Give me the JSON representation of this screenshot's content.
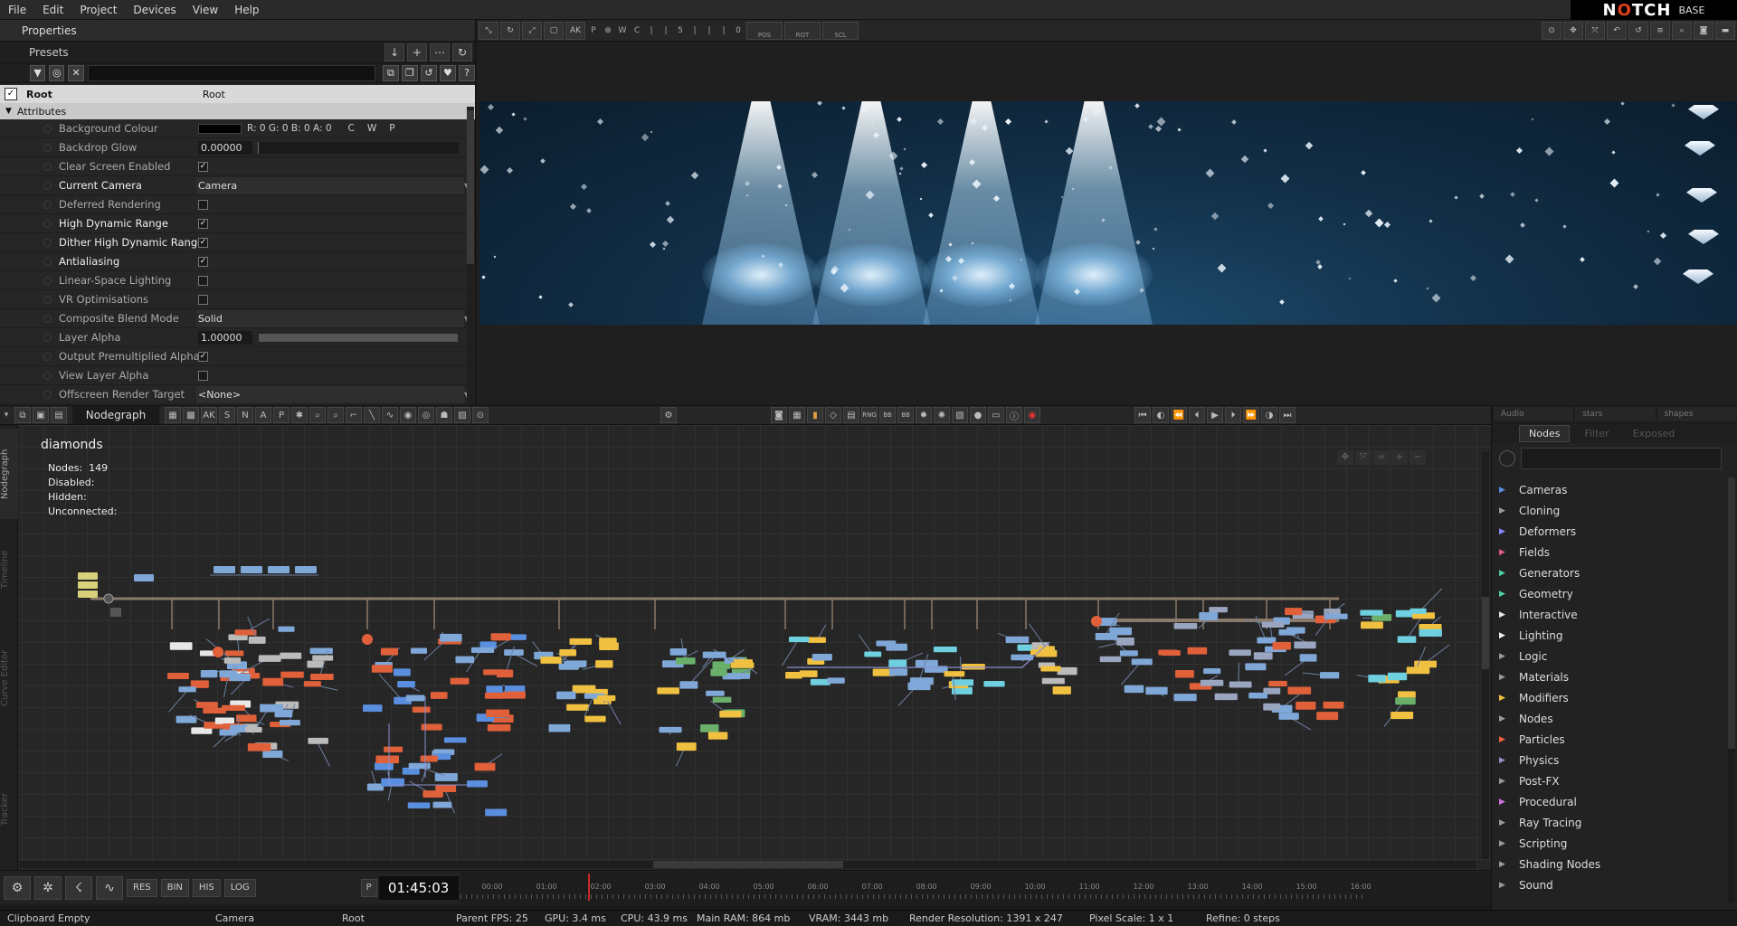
{
  "menu": [
    "File",
    "Edit",
    "Project",
    "Devices",
    "View",
    "Help"
  ],
  "logo": {
    "brand_prefix": "N",
    "brand_o": "O",
    "brand_suffix": "TCH",
    "edition": "BASE"
  },
  "properties": {
    "title": "Properties",
    "presets_label": "Presets",
    "root": {
      "label": "Root",
      "value": "Root"
    },
    "section": "Attributes",
    "rows": [
      {
        "label": "Background Colour",
        "type": "colour",
        "text": "R: 0 G: 0 B: 0 A: 0",
        "modes": [
          "C",
          "W",
          "P"
        ],
        "bright": false
      },
      {
        "label": "Backdrop Glow",
        "type": "number",
        "value": "0.00000",
        "bright": false
      },
      {
        "label": "Clear Screen Enabled",
        "type": "check",
        "checked": true,
        "bright": false
      },
      {
        "label": "Current Camera",
        "type": "drop",
        "value": "Camera",
        "bright": true
      },
      {
        "label": "Deferred Rendering",
        "type": "check",
        "checked": false,
        "bright": false
      },
      {
        "label": "High Dynamic Range",
        "type": "check",
        "checked": true,
        "bright": true
      },
      {
        "label": "Dither High Dynamic Range",
        "type": "check",
        "checked": true,
        "bright": true
      },
      {
        "label": "Antialiasing",
        "type": "check",
        "checked": true,
        "bright": true
      },
      {
        "label": "Linear-Space Lighting",
        "type": "check",
        "checked": false,
        "bright": false
      },
      {
        "label": "VR Optimisations",
        "type": "check",
        "checked": false,
        "bright": false
      },
      {
        "label": "Composite Blend Mode",
        "type": "drop",
        "value": "Solid",
        "bright": false
      },
      {
        "label": "Layer Alpha",
        "type": "slider",
        "value": "1.00000",
        "bright": false
      },
      {
        "label": "Output Premultiplied Alpha",
        "type": "check",
        "checked": true,
        "bright": false
      },
      {
        "label": "View Layer Alpha",
        "type": "check",
        "checked": false,
        "bright": false
      },
      {
        "label": "Offscreen Render Target",
        "type": "drop",
        "value": "<None>",
        "bright": false
      }
    ]
  },
  "viewport_toolbar": {
    "pos_label": "POS",
    "rot_label": "ROT",
    "scl_label": "SCL",
    "ak_label": "AK",
    "p_label": "P",
    "w_label": "W",
    "c_label": "C",
    "count_label": "5",
    "zero_label": "0"
  },
  "nodegraph": {
    "title": "Nodegraph",
    "toolbar_letters": [
      "AK",
      "S",
      "N",
      "A",
      "P"
    ],
    "toolbar_extra": [
      "RNG",
      "BB",
      "BB"
    ],
    "graph_name": "diamonds",
    "stats": {
      "nodes_label": "Nodes:",
      "nodes_value": "149",
      "disabled_label": "Disabled:",
      "hidden_label": "Hidden:",
      "unconnected_label": "Unconnected:"
    },
    "side_tabs": [
      "Nodegraph",
      "Timeline",
      "Curve Editor",
      "Tracker"
    ]
  },
  "node_bin": {
    "top_tabs": [
      "Audio",
      "stars",
      "shapes"
    ],
    "sub_tabs": [
      "Nodes",
      "Filter",
      "Exposed",
      "Exposed"
    ],
    "categories": [
      {
        "name": "Cameras",
        "color": "#5a8fe0"
      },
      {
        "name": "Cloning",
        "color": "#9a9a9a"
      },
      {
        "name": "Deformers",
        "color": "#8a8aff"
      },
      {
        "name": "Fields",
        "color": "#e05a8a"
      },
      {
        "name": "Generators",
        "color": "#4fcfa0"
      },
      {
        "name": "Geometry",
        "color": "#4fcfa0"
      },
      {
        "name": "Interactive",
        "color": "#e8e8e8"
      },
      {
        "name": "Lighting",
        "color": "#f0f0f0"
      },
      {
        "name": "Logic",
        "color": "#9a9a9a"
      },
      {
        "name": "Materials",
        "color": "#9a9a9a"
      },
      {
        "name": "Modifiers",
        "color": "#f0c040"
      },
      {
        "name": "Nodes",
        "color": "#9a9a9a"
      },
      {
        "name": "Particles",
        "color": "#f06040"
      },
      {
        "name": "Physics",
        "color": "#9090c0"
      },
      {
        "name": "Post-FX",
        "color": "#9a9a9a"
      },
      {
        "name": "Procedural",
        "color": "#d070e0"
      },
      {
        "name": "Ray Tracing",
        "color": "#9a9a9a"
      },
      {
        "name": "Scripting",
        "color": "#9a9a9a"
      },
      {
        "name": "Shading Nodes",
        "color": "#9a9a9a"
      },
      {
        "name": "Sound",
        "color": "#9a9a9a"
      }
    ]
  },
  "bottom": {
    "buttons": [
      "RES",
      "BIN",
      "HIS",
      "LOG"
    ],
    "p_label": "P",
    "timecode": "01:45:03",
    "ruler_ticks": [
      "00:00",
      "01:00",
      "02:00",
      "03:00",
      "04:00",
      "05:00",
      "06:00",
      "07:00",
      "08:00",
      "09:00",
      "10:00",
      "11:00",
      "12:00",
      "13:00",
      "14:00",
      "15:00",
      "16:00"
    ],
    "playhead_time": "01:45"
  },
  "status": {
    "clipboard": "Clipboard Empty",
    "camera": "Camera",
    "root": "Root",
    "parent_fps": "Parent  FPS: 25",
    "gpu": "GPU: 3.4 ms",
    "cpu": "CPU: 43.9 ms",
    "ram": "Main RAM: 864 mb",
    "vram": "VRAM: 3443 mb",
    "render_res": "Render Resolution: 1391 x 247",
    "pixel_scale": "Pixel Scale: 1 x 1",
    "refine": "Refine: 0 steps"
  }
}
